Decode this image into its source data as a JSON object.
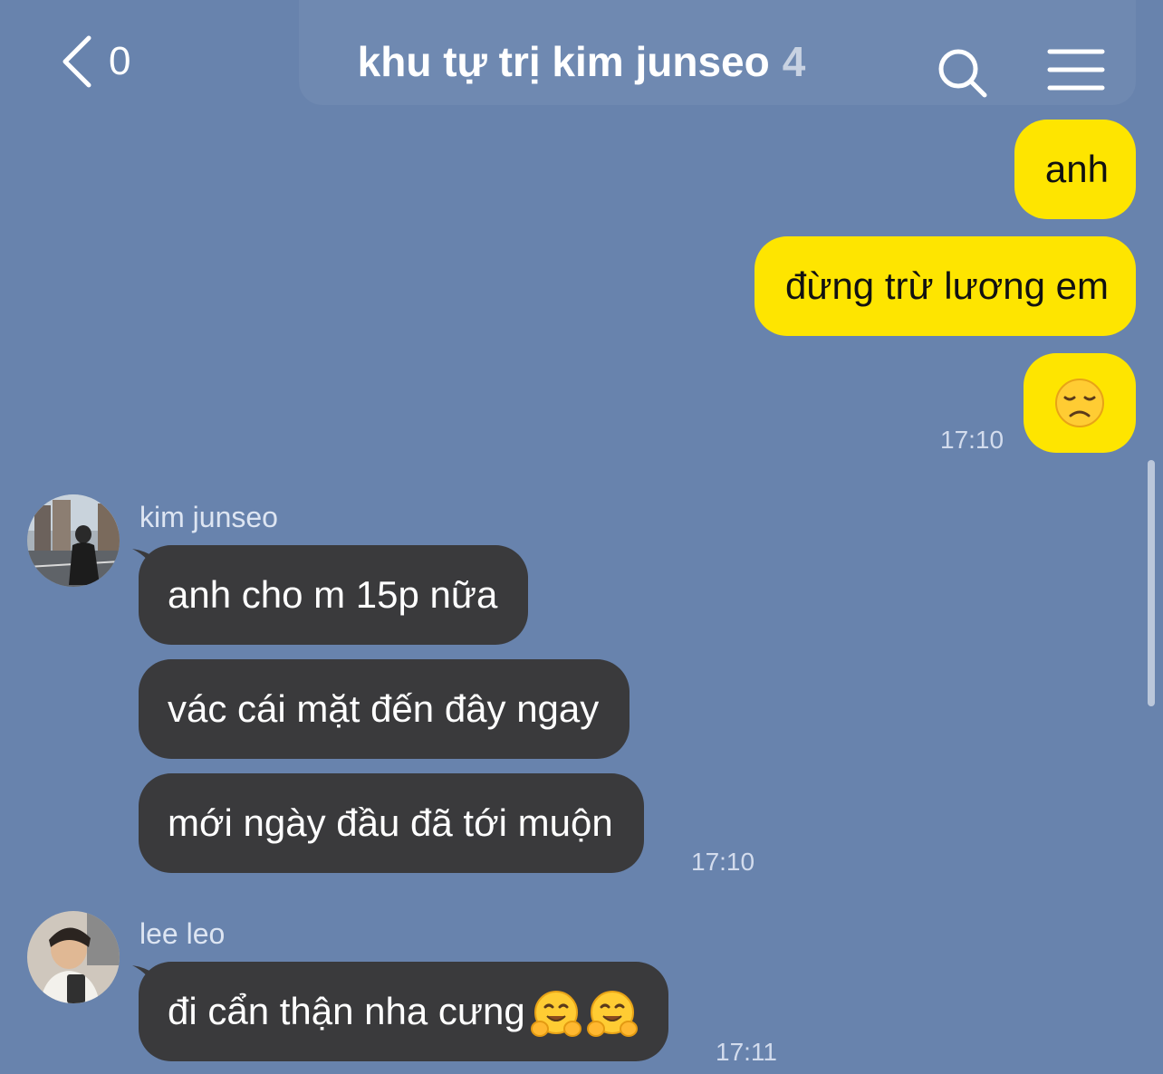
{
  "header": {
    "back_count": "0",
    "title": "khu tự trị kim junseo",
    "member_count": "4"
  },
  "icons": {
    "back": "chevron-left-icon",
    "search": "search-icon",
    "menu": "hamburger-menu-icon"
  },
  "colors": {
    "background": "#6883ad",
    "outgoing_bubble": "#fee500",
    "incoming_bubble": "#3a3a3c"
  },
  "messages": {
    "outgoing": [
      {
        "text": "anh"
      },
      {
        "text": "đừng trừ lương em"
      },
      {
        "emoji": "disappointed-face-emoji",
        "time": "17:10"
      }
    ],
    "group1": {
      "sender": "kim junseo",
      "messages": [
        {
          "text": "anh cho m 15p nữa"
        },
        {
          "text": "vác cái mặt đến đây ngay"
        },
        {
          "text": "mới ngày đầu đã tới muộn"
        }
      ],
      "time": "17:10"
    },
    "group2": {
      "sender": "lee leo",
      "messages": [
        {
          "text": "đi cẩn thận nha cưng"
        }
      ],
      "emojis": [
        "hugging-face-emoji",
        "hugging-face-emoji"
      ],
      "time": "17:11"
    }
  }
}
